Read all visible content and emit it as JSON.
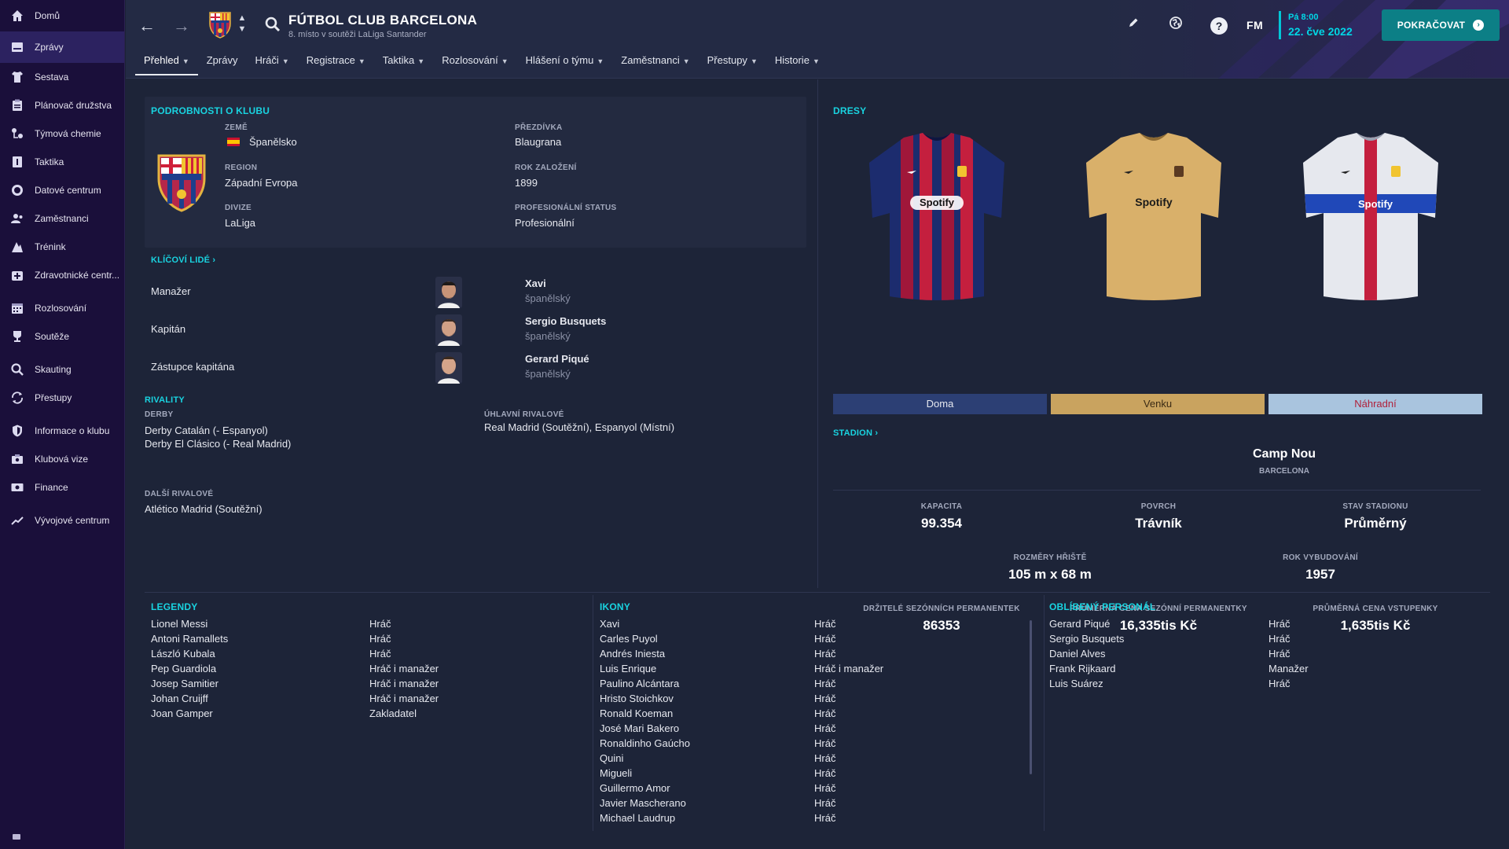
{
  "sidebar": {
    "items": [
      {
        "label": "Domů",
        "icon": "home-icon"
      },
      {
        "label": "Zprávy",
        "icon": "inbox-icon"
      },
      {
        "label": "Sestava",
        "icon": "shirt-icon"
      },
      {
        "label": "Plánovač družstva",
        "icon": "clipboard-icon"
      },
      {
        "label": "Týmová chemie",
        "icon": "chemistry-icon"
      },
      {
        "label": "Taktika",
        "icon": "tactics-icon"
      },
      {
        "label": "Datové centrum",
        "icon": "data-icon"
      },
      {
        "label": "Zaměstnanci",
        "icon": "staff-icon"
      },
      {
        "label": "Trénink",
        "icon": "training-icon"
      },
      {
        "label": "Zdravotnické centr...",
        "icon": "medical-icon"
      },
      {
        "label": "Rozlosování",
        "icon": "calendar-icon"
      },
      {
        "label": "Soutěže",
        "icon": "trophy-icon"
      },
      {
        "label": "Skauting",
        "icon": "scouting-icon"
      },
      {
        "label": "Přestupy",
        "icon": "transfers-icon"
      },
      {
        "label": "Informace o klubu",
        "icon": "shield-icon"
      },
      {
        "label": "Klubová vize",
        "icon": "vision-icon"
      },
      {
        "label": "Finance",
        "icon": "finance-icon"
      },
      {
        "label": "Vývojové centrum",
        "icon": "development-icon"
      }
    ]
  },
  "header": {
    "club_name": "FÚTBOL CLUB BARCELONA",
    "club_subtitle": "8. místo v soutěži LaLiga Santander",
    "fm_logo": "FM",
    "date_time": "Pá 8:00",
    "date_day": "22. čve 2022",
    "continue_label": "POKRAČOVAT",
    "help_glyph": "?",
    "tabs": [
      {
        "label": "Přehled",
        "chevron": true
      },
      {
        "label": "Zprávy",
        "chevron": false
      },
      {
        "label": "Hráči",
        "chevron": true
      },
      {
        "label": "Registrace",
        "chevron": true
      },
      {
        "label": "Taktika",
        "chevron": true
      },
      {
        "label": "Rozlosování",
        "chevron": true
      },
      {
        "label": "Hlášení o týmu",
        "chevron": true
      },
      {
        "label": "Zaměstnanci",
        "chevron": true
      },
      {
        "label": "Přestupy",
        "chevron": true
      },
      {
        "label": "Historie",
        "chevron": true
      }
    ]
  },
  "details": {
    "title": "PODROBNOSTI O KLUBU",
    "country_label": "ZEMĚ",
    "country": "Španělsko",
    "region_label": "REGION",
    "region": "Západní Evropa",
    "division_label": "DIVIZE",
    "division": "LaLiga",
    "nickname_label": "PŘEZDÍVKA",
    "nickname": "Blaugrana",
    "founded_label": "ROK ZALOŽENÍ",
    "founded": "1899",
    "status_label": "PROFESIONÁLNÍ STATUS",
    "status": "Profesionální"
  },
  "key_people": {
    "title": "KLÍČOVÍ LIDÉ",
    "rows": [
      {
        "role": "Manažer",
        "name": "Xavi",
        "nationality": "španělský"
      },
      {
        "role": "Kapitán",
        "name": "Sergio Busquets",
        "nationality": "španělský"
      },
      {
        "role": "Zástupce kapitána",
        "name": "Gerard Piqué",
        "nationality": "španělský"
      }
    ]
  },
  "rivalry": {
    "title": "RIVALITY",
    "derby_label": "DERBY",
    "derby_1": "Derby Catalán (- Espanyol)",
    "derby_2": "Derby El Clásico (- Real Madrid)",
    "main_label": "ÚHLAVNÍ RIVALOVÉ",
    "main": "Real Madrid (Soutěžní), Espanyol (Místní)",
    "other_label": "DALŠÍ RIVALOVÉ",
    "other": "Atlético Madrid (Soutěžní)"
  },
  "kits": {
    "title": "DRESY",
    "sponsor": "Spotify",
    "home": "Doma",
    "away": "Venku",
    "third": "Náhradní",
    "colors": {
      "home_label_bg": "#2c3f74",
      "away_label_bg": "#c9a35f",
      "third_label_bg": "#a9c4de"
    }
  },
  "stadium": {
    "title": "STADION",
    "name": "Camp Nou",
    "city": "BARCELONA",
    "capacity_label": "KAPACITA",
    "capacity": "99.354",
    "surface_label": "POVRCH",
    "surface": "Trávník",
    "condition_label": "STAV STADIONU",
    "condition": "Průměrný",
    "pitch_label": "ROZMĚRY HŘIŠTĚ",
    "pitch": "105 m x 68 m",
    "built_label": "ROK VYBUDOVÁNÍ",
    "built": "1957",
    "holders_label": "DRŽITELÉ SEZÓNNÍCH PERMANENTEK",
    "holders": "86353",
    "season_price_label": "PRŮMĚRNÁ CENA SEZÓNNÍ PERMANENTKY",
    "season_price": "16,335tis Kč",
    "ticket_price_label": "PRŮMĚRNÁ CENA VSTUPENKY",
    "ticket_price": "1,635tis Kč"
  },
  "legends": {
    "title": "LEGENDY",
    "rows": [
      {
        "name": "Lionel Messi",
        "role": "Hráč"
      },
      {
        "name": "Antoni Ramallets",
        "role": "Hráč"
      },
      {
        "name": "László Kubala",
        "role": "Hráč"
      },
      {
        "name": "Pep Guardiola",
        "role": "Hráč i manažer"
      },
      {
        "name": "Josep Samitier",
        "role": "Hráč i manažer"
      },
      {
        "name": "Johan Cruijff",
        "role": "Hráč i manažer"
      },
      {
        "name": "Joan Gamper",
        "role": "Zakladatel"
      }
    ]
  },
  "icons": {
    "title": "IKONY",
    "rows": [
      {
        "name": "Xavi",
        "role": "Hráč"
      },
      {
        "name": "Carles Puyol",
        "role": "Hráč"
      },
      {
        "name": "Andrés Iniesta",
        "role": "Hráč"
      },
      {
        "name": "Luis Enrique",
        "role": "Hráč i manažer"
      },
      {
        "name": "Paulino Alcántara",
        "role": "Hráč"
      },
      {
        "name": "Hristo Stoichkov",
        "role": "Hráč"
      },
      {
        "name": "Ronald Koeman",
        "role": "Hráč"
      },
      {
        "name": "José Mari Bakero",
        "role": "Hráč"
      },
      {
        "name": "Ronaldinho Gaúcho",
        "role": "Hráč"
      },
      {
        "name": "Quini",
        "role": "Hráč"
      },
      {
        "name": "Migueli",
        "role": "Hráč"
      },
      {
        "name": "Guillermo Amor",
        "role": "Hráč"
      },
      {
        "name": "Javier Mascherano",
        "role": "Hráč"
      },
      {
        "name": "Michael Laudrup",
        "role": "Hráč"
      }
    ]
  },
  "favourites": {
    "title": "OBLÍBENÝ PERSONÁL",
    "rows": [
      {
        "name": "Gerard Piqué",
        "role": "Hráč"
      },
      {
        "name": "Sergio Busquets",
        "role": "Hráč"
      },
      {
        "name": "Daniel Alves",
        "role": "Hráč"
      },
      {
        "name": "Frank Rijkaard",
        "role": "Manažer"
      },
      {
        "name": "Luis Suárez",
        "role": "Hráč"
      }
    ]
  },
  "accent_color": "#19d3e0"
}
